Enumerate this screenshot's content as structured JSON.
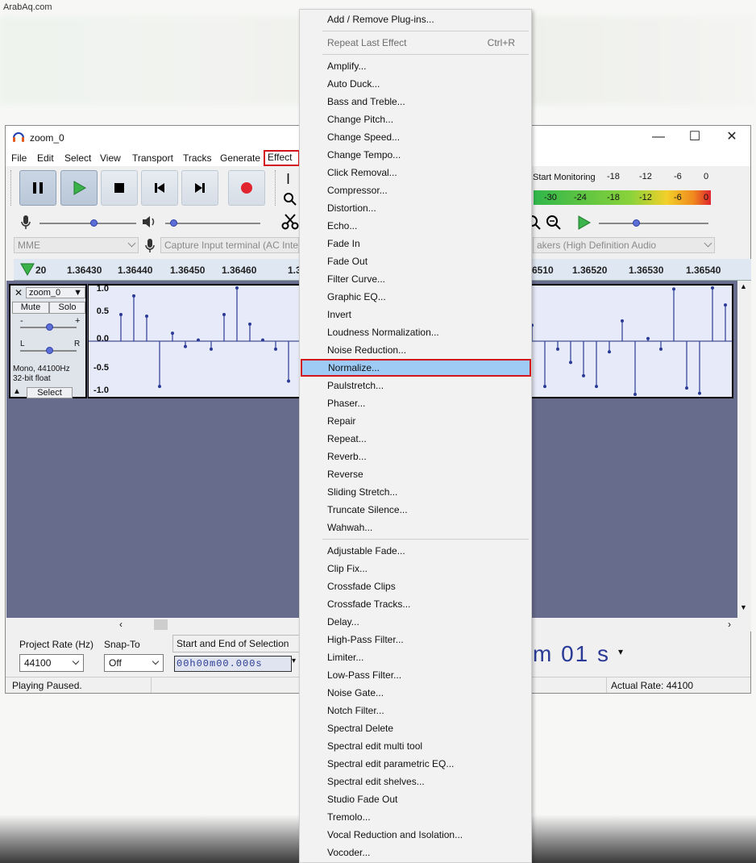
{
  "watermark": "ArabAq.com",
  "window": {
    "title": "zoom_0",
    "controls": {
      "minimize": "—",
      "maximize": "☐",
      "close": "✕"
    }
  },
  "menubar": [
    "File",
    "Edit",
    "Select",
    "View",
    "Transport",
    "Tracks",
    "Generate",
    "Effect"
  ],
  "toolbar": {
    "monitoring": "Start Monitoring",
    "meter_rec_ticks": [
      "-18",
      "-12",
      "-6",
      "0"
    ],
    "meter_play_ticks": [
      "-30",
      "-24",
      "-18",
      "-12",
      "-6",
      "0"
    ],
    "host": "MME",
    "input_device": "Capture Input terminal (AC Inte",
    "output_device": "akers (High Definition Audio"
  },
  "ruler": {
    "left_labels": [
      "20",
      "1.36430",
      "1.36440",
      "1.36450",
      "1.36460",
      "1.3"
    ],
    "right_labels": [
      "6510",
      "1.36520",
      "1.36530",
      "1.36540"
    ]
  },
  "track": {
    "name": "zoom_0",
    "mute": "Mute",
    "solo": "Solo",
    "gain_minus": "-",
    "gain_plus": "+",
    "pan_l": "L",
    "pan_r": "R",
    "info_line1": "Mono, 44100Hz",
    "info_line2": "32-bit float",
    "select": "Select",
    "scale": [
      "1.0",
      "0.5",
      "0.0",
      "-0.5",
      "-1.0"
    ]
  },
  "bottom": {
    "project_rate_label": "Project Rate (Hz)",
    "project_rate_value": "44100",
    "snap_to_label": "Snap-To",
    "snap_to_value": "Off",
    "selection_label": "Start and End of Selection",
    "selection_time": "00h00m00.000s",
    "audio_position": "m 01 s"
  },
  "status": {
    "left": "Playing Paused.",
    "right": "Actual Rate: 44100"
  },
  "effect_menu": {
    "top": [
      {
        "label": "Add / Remove Plug-ins..."
      }
    ],
    "repeat": {
      "label": "Repeat Last Effect",
      "shortcut": "Ctrl+R"
    },
    "group1": [
      "Amplify...",
      "Auto Duck...",
      "Bass and Treble...",
      "Change Pitch...",
      "Change Speed...",
      "Change Tempo...",
      "Click Removal...",
      "Compressor...",
      "Distortion...",
      "Echo...",
      "Fade In",
      "Fade Out",
      "Filter Curve...",
      "Graphic EQ...",
      "Invert",
      "Loudness Normalization...",
      "Noise Reduction...",
      "Normalize...",
      "Paulstretch...",
      "Phaser...",
      "Repair",
      "Repeat...",
      "Reverb...",
      "Reverse",
      "Sliding Stretch...",
      "Truncate Silence...",
      "Wahwah..."
    ],
    "group2": [
      "Adjustable Fade...",
      "Clip Fix...",
      "Crossfade Clips",
      "Crossfade Tracks...",
      "Delay...",
      "High-Pass Filter...",
      "Limiter...",
      "Low-Pass Filter...",
      "Noise Gate...",
      "Notch Filter...",
      "Spectral Delete",
      "Spectral edit multi tool",
      "Spectral edit parametric EQ...",
      "Spectral edit shelves...",
      "Studio Fade Out",
      "Tremolo...",
      "Vocal Reduction and Isolation...",
      "Vocoder..."
    ],
    "highlighted": "Normalize..."
  },
  "waveform": {
    "samples_left": [
      0.5,
      0.85,
      0.47,
      -0.85,
      0.15,
      -0.1,
      0.02,
      -0.15,
      0.5,
      1.0,
      0.32,
      0.02,
      -0.15,
      -0.75
    ],
    "samples_right": [
      0.3,
      -0.85,
      -0.15,
      -0.4,
      -0.65,
      -0.85,
      -0.2,
      0.38,
      -1.0,
      0.05,
      -0.15,
      0.98,
      -0.88,
      -0.98,
      1.0,
      0.68
    ]
  },
  "colors": {
    "accent_blue": "#2a3a96",
    "highlight": "#9dcbf5",
    "annotation_red": "#d4141c",
    "track_bg": "#686c8c",
    "wave_bg": "#e7eaf8"
  }
}
